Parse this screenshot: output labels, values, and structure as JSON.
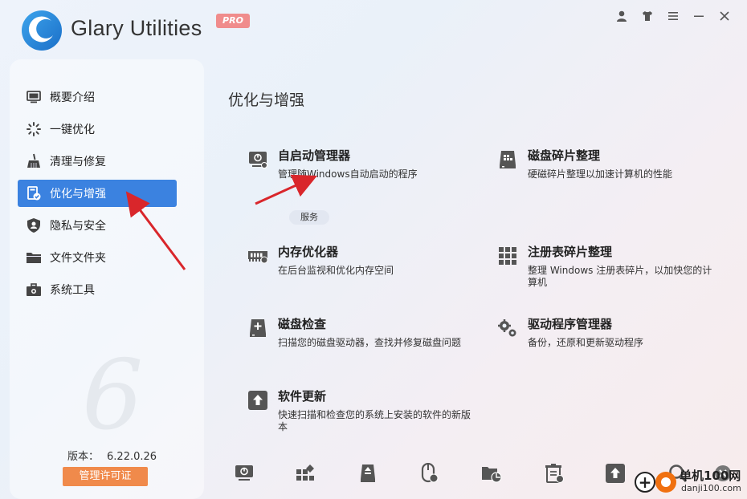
{
  "app": {
    "title": "Glary Utilities",
    "badge": "PRO"
  },
  "titlebar_icons": [
    "user-icon",
    "shirt-icon",
    "menu-icon",
    "minimize-icon",
    "close-icon"
  ],
  "sidebar": {
    "items": [
      {
        "label": "概要介绍",
        "icon": "monitor-icon"
      },
      {
        "label": "一键优化",
        "icon": "sparkle-icon"
      },
      {
        "label": "清理与修复",
        "icon": "broom-icon"
      },
      {
        "label": "优化与增强",
        "icon": "optimize-icon",
        "active": true
      },
      {
        "label": "隐私与安全",
        "icon": "shield-icon"
      },
      {
        "label": "文件文件夹",
        "icon": "folder-icon"
      },
      {
        "label": "系统工具",
        "icon": "toolbox-icon"
      }
    ],
    "version_label": "版本：",
    "version_value": "6.22.0.26",
    "license_button": "管理许可证"
  },
  "main": {
    "title": "优化与增强",
    "service_badge": "服务",
    "tools": [
      {
        "name": "自启动管理器",
        "desc": "管理随Windows自动启动的程序",
        "icon": "startup-icon"
      },
      {
        "name": "磁盘碎片整理",
        "desc": "硬磁碎片整理以加速计算机的性能",
        "icon": "defrag-icon"
      },
      {
        "name": "内存优化器",
        "desc": "在后台监视和优化内存空间",
        "icon": "memory-icon"
      },
      {
        "name": "注册表碎片整理",
        "desc": "整理 Windows 注册表碎片，以加快您的计算机",
        "icon": "registry-icon"
      },
      {
        "name": "磁盘检查",
        "desc": "扫描您的磁盘驱动器，查找并修复磁盘问题",
        "icon": "disk-check-icon"
      },
      {
        "name": "驱动程序管理器",
        "desc": "备份，还原和更新驱动程序",
        "icon": "driver-icon"
      },
      {
        "name": "软件更新",
        "desc": "快速扫描和检查您的系统上安装的软件的新版本",
        "icon": "update-icon"
      }
    ]
  },
  "bottom_toolbar": [
    "startup-icon",
    "registry-icon",
    "disk-cleaner-icon",
    "mouse-icon",
    "disk-space-icon",
    "uninstall-icon",
    "update-icon",
    "add-icon",
    "search-icon",
    "close-icon"
  ],
  "watermark": {
    "cn": "单机100网",
    "url": "danji100.com"
  },
  "colors": {
    "accent": "#3b82e0",
    "license": "#f08a4b",
    "pro_badge": "#f08c8c",
    "arrow": "#d9262b"
  }
}
